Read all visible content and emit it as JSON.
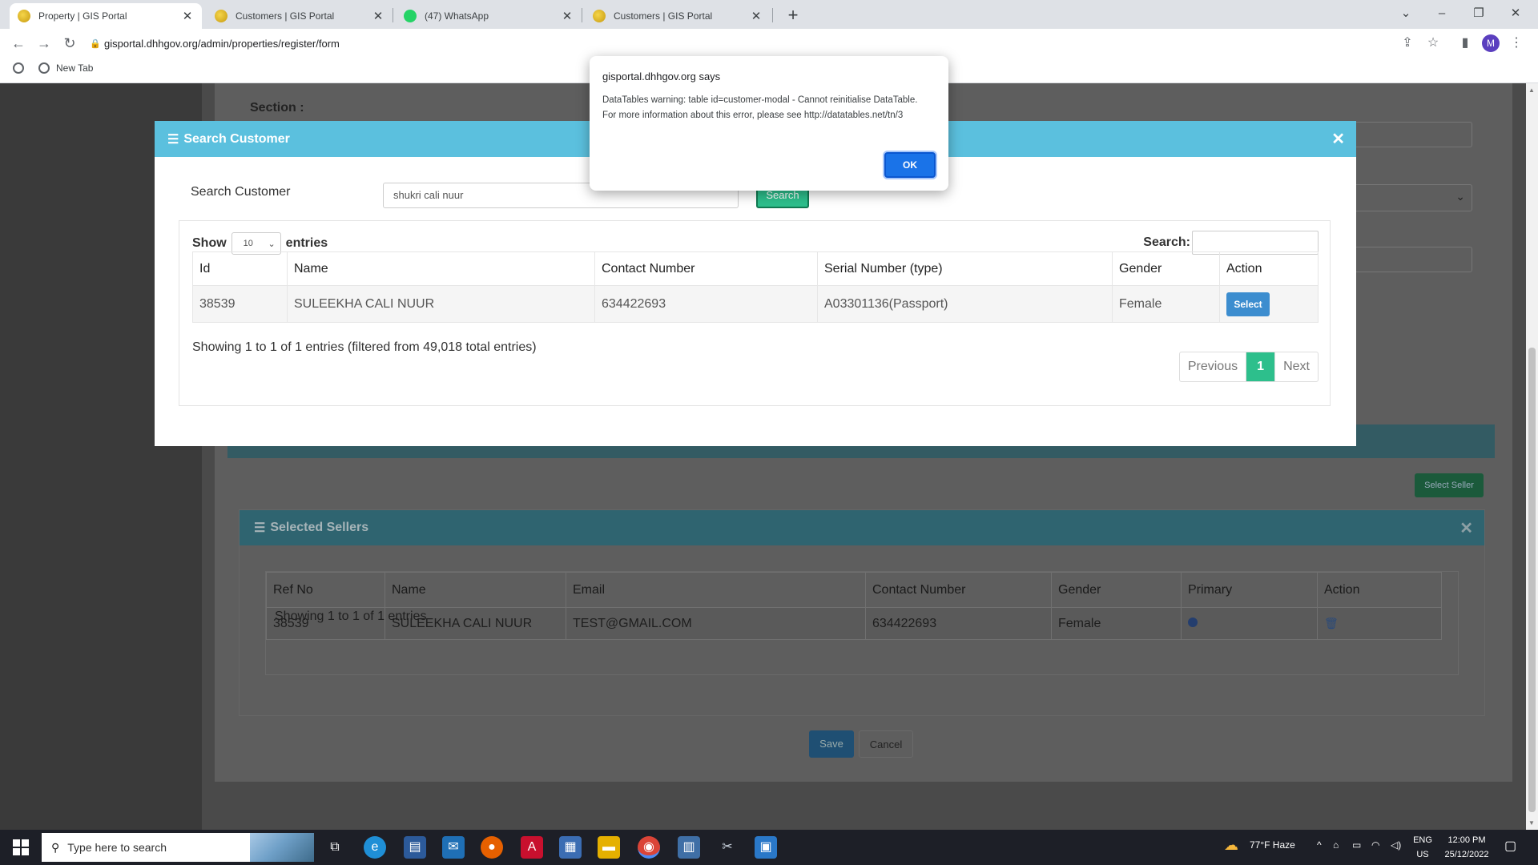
{
  "browser": {
    "tabs": [
      {
        "label": "Property | GIS Portal",
        "active": true,
        "favicon": "gis-logo-icon"
      },
      {
        "label": "Customers | GIS Portal",
        "active": false,
        "favicon": "gis-logo-icon"
      },
      {
        "label": "(47) WhatsApp",
        "active": false,
        "favicon": "whatsapp-icon"
      },
      {
        "label": "Customers | GIS Portal",
        "active": false,
        "favicon": "gis-logo-icon"
      }
    ],
    "url": "gisportal.dhhgov.org/admin/properties/register/form",
    "bookmark": "New Tab",
    "profile_initial": "M"
  },
  "background_page": {
    "section_label": "Section :",
    "select_seller_label": "Select Seller",
    "selected_sellers": {
      "title": "Selected Sellers",
      "columns": [
        "Ref No",
        "Name",
        "Email",
        "Contact Number",
        "Gender",
        "Primary",
        "Action"
      ],
      "rows": [
        {
          "ref_no": "38539",
          "name": "SULEEKHA CALI NUUR",
          "email": "TEST@GMAIL.COM",
          "contact": "634422693",
          "gender": "Female",
          "primary": true
        }
      ],
      "info": "Showing 1 to 1 of 1 entries"
    },
    "save_label": "Save",
    "cancel_label": "Cancel"
  },
  "modal": {
    "title": "Search Customer",
    "search_label": "Search Customer",
    "search_value": "shukri cali nuur",
    "search_button": "Search",
    "length": {
      "show": "Show",
      "value": "10",
      "entries": "entries"
    },
    "filter_label": "Search:",
    "columns": [
      "Id",
      "Name",
      "Contact Number",
      "Serial Number (type)",
      "Gender",
      "Action"
    ],
    "rows": [
      {
        "id": "38539",
        "name": "SULEEKHA CALI NUUR",
        "contact": "634422693",
        "serial": "A03301136(Passport)",
        "gender": "Female",
        "action": "Select"
      }
    ],
    "info": "Showing 1 to 1 of 1 entries (filtered from 49,018 total entries)",
    "pager": {
      "previous": "Previous",
      "current": "1",
      "next": "Next"
    }
  },
  "alert": {
    "title": "gisportal.dhhgov.org says",
    "message": "DataTables warning: table id=customer-modal - Cannot reinitialise DataTable. For more information about this error, please see http://datatables.net/tn/3",
    "ok": "OK"
  },
  "taskbar": {
    "search_placeholder": "Type here to search",
    "weather": "77°F  Haze",
    "lang_top": "ENG",
    "lang_bottom": "US",
    "time": "12:00 PM",
    "date": "25/12/2022"
  },
  "colors": {
    "modal_header": "#5bc0de",
    "search_button": "#2dbf8c",
    "select_button": "#3c8dcf",
    "alert_ok": "#1a73e8"
  }
}
